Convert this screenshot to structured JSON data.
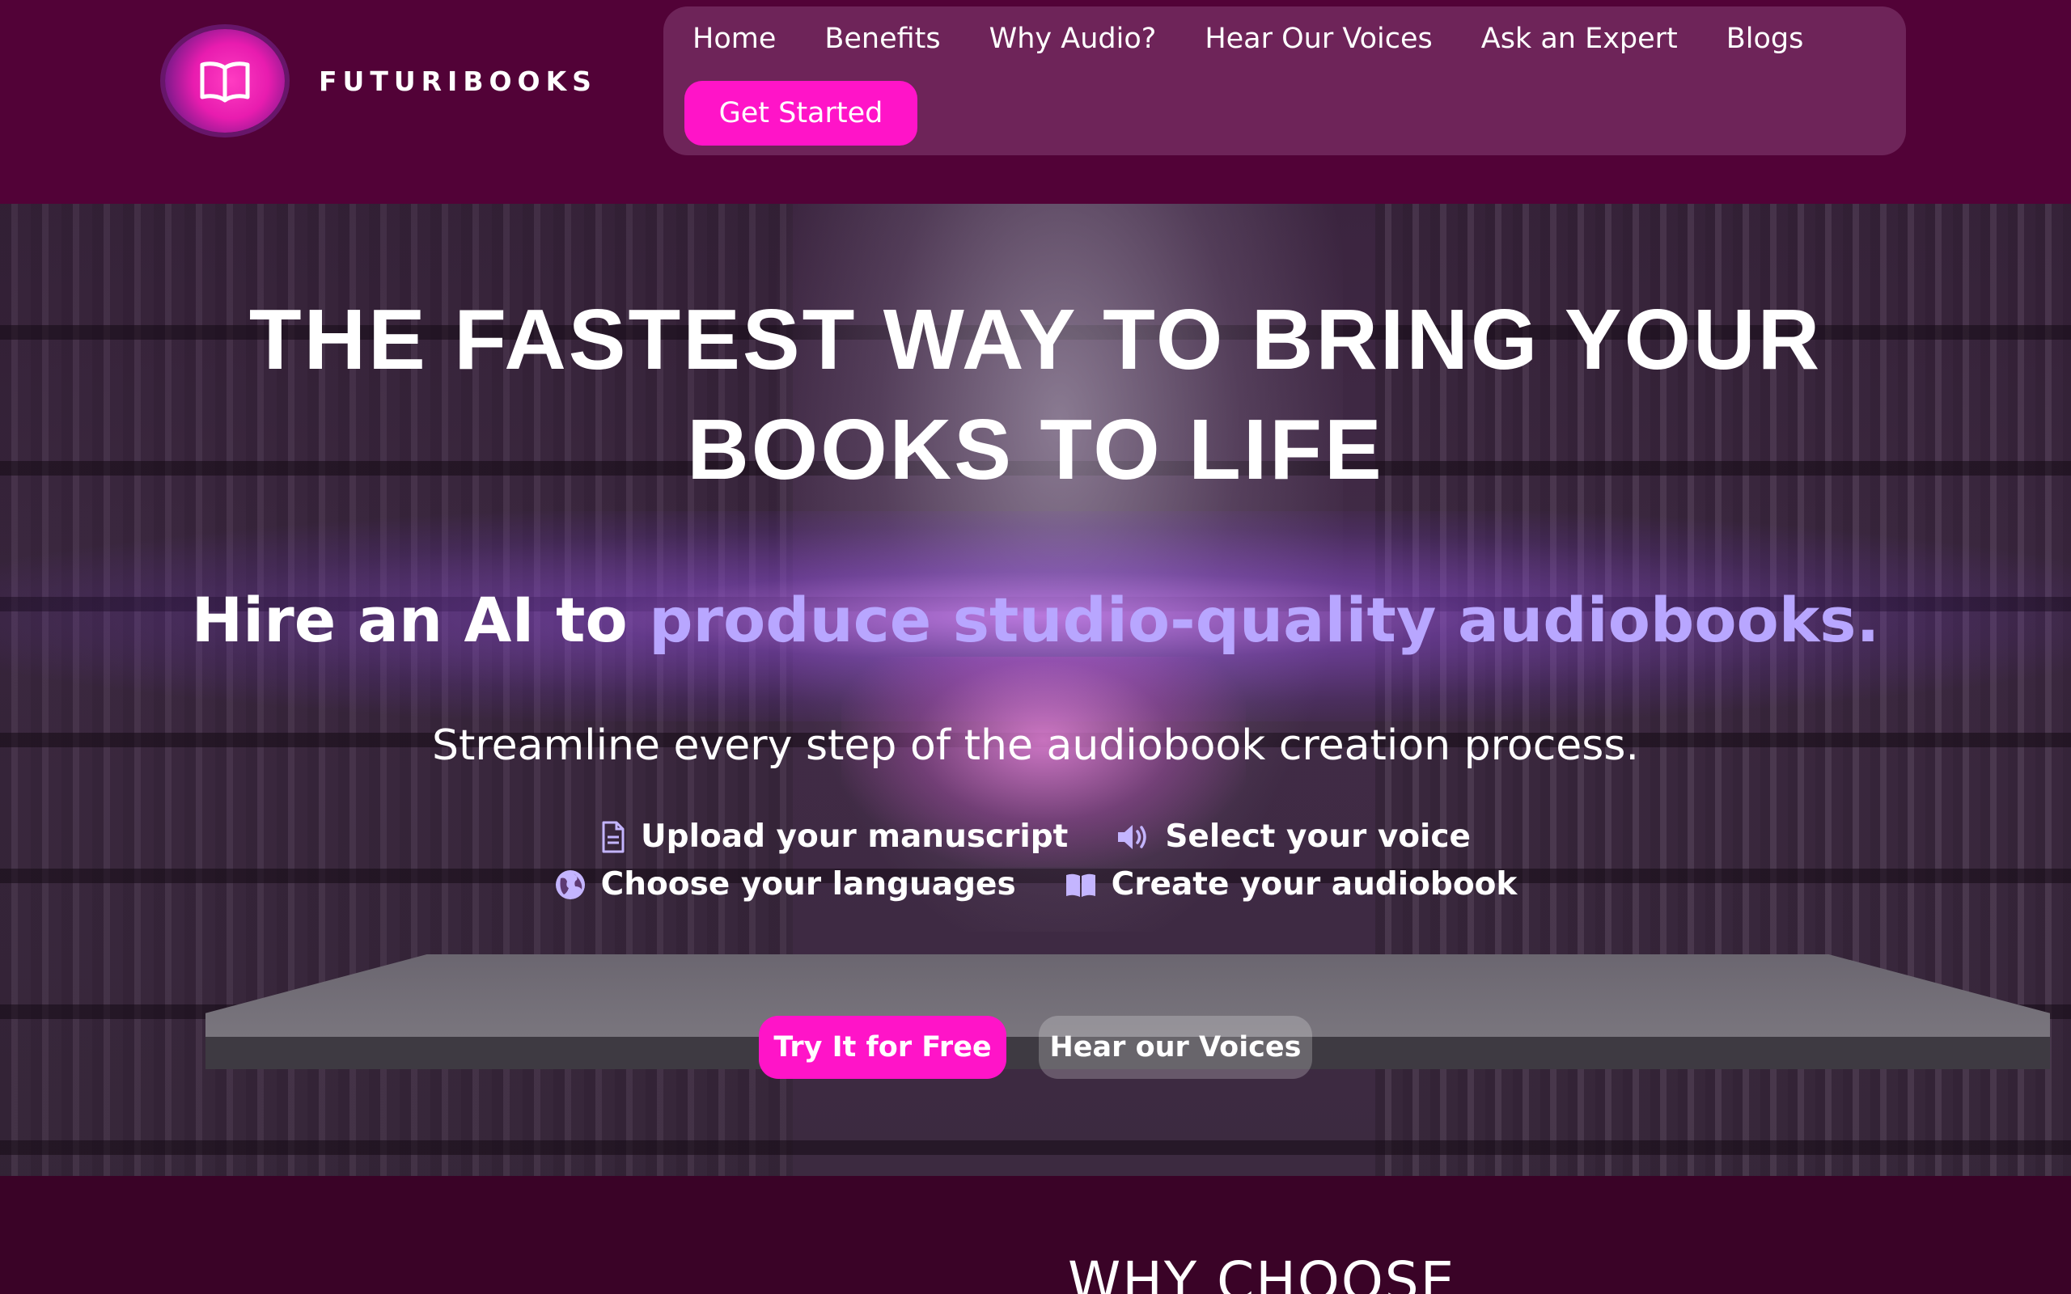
{
  "brand": {
    "name": "FUTURIBOOKS",
    "logo_icon": "open-book-icon",
    "accent": "#ff14c8"
  },
  "nav": {
    "links": [
      "Home",
      "Benefits",
      "Why Audio?",
      "Hear Our Voices",
      "Ask an Expert",
      "Blogs"
    ],
    "cta": "Get Started"
  },
  "hero": {
    "title_line1": "THE FASTEST WAY TO BRING YOUR",
    "title_line2": "BOOKS TO LIFE",
    "sub_plain": "Hire an AI to ",
    "sub_accent": "produce studio-quality audiobooks.",
    "sub_accent_color": "#b8a6ff",
    "description": "Streamline every step of the audiobook creation process.",
    "steps": [
      {
        "icon": "document-icon",
        "label": "Upload your manuscript"
      },
      {
        "icon": "speaker-icon",
        "label": "Select your voice"
      },
      {
        "icon": "globe-icon",
        "label": "Choose your languages"
      },
      {
        "icon": "book-icon",
        "label": "Create your audiobook"
      }
    ],
    "primary_cta": "Try It for Free",
    "secondary_cta": "Hear our Voices"
  },
  "section": {
    "heading": "WHY CHOOSE"
  }
}
